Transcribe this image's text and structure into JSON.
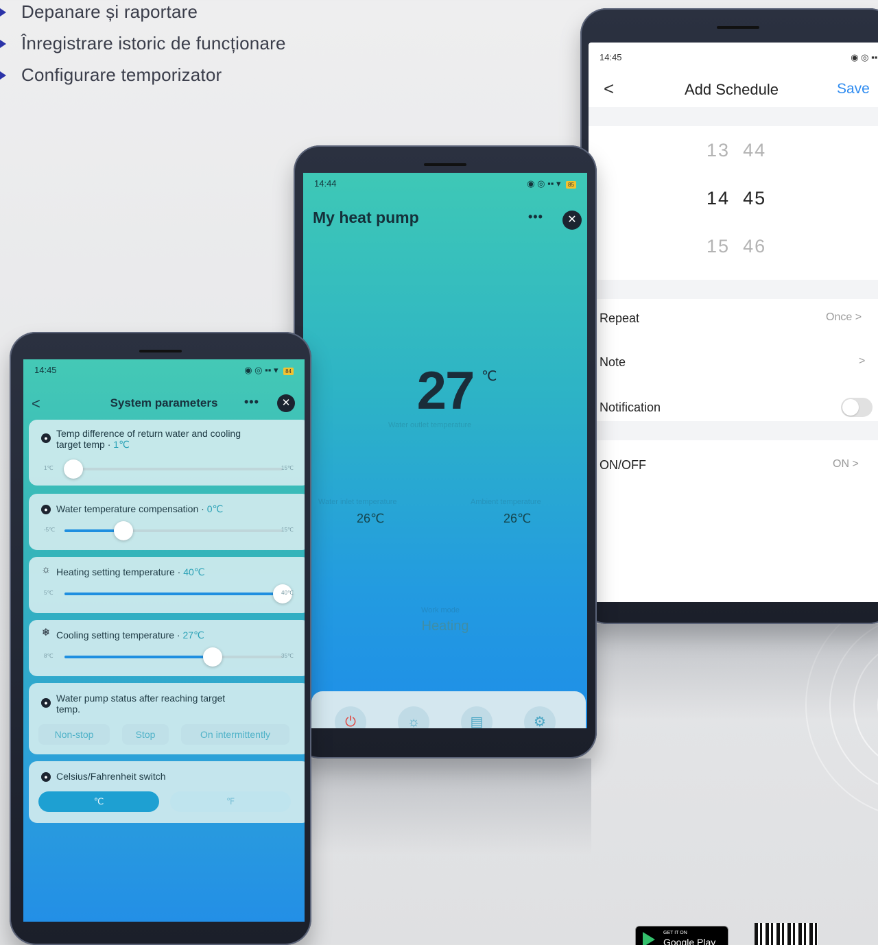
{
  "features": [
    "Depanare și raportare",
    "Înregistrare istoric de funcționare",
    "Configurare temporizator"
  ],
  "phone_system": {
    "status_time": "14:45",
    "battery": "84",
    "title": "System parameters",
    "back_glyph": "<",
    "more_glyph": "•••",
    "close_glyph": "✕",
    "cards": [
      {
        "label": "Temp difference of return water and cooling",
        "label2": "target temp",
        "value": "1℃",
        "min": "1℃",
        "max": "15℃",
        "fraction": 0.04
      },
      {
        "label": "Water temperature compensation",
        "value": "0℃",
        "min": "-5℃",
        "max": "15℃",
        "fraction": 0.27
      },
      {
        "label": "Heating setting temperature",
        "value": "40℃",
        "min": "5℃",
        "max": "40℃",
        "fraction": 1.0
      },
      {
        "label": "Cooling setting temperature",
        "value": "27℃",
        "min": "8℃",
        "max": "35℃",
        "fraction": 0.68
      }
    ],
    "pump_status": {
      "label": "Water pump status after reaching target",
      "label2": "temp.",
      "options": [
        "Non-stop",
        "Stop",
        "On intermittently"
      ]
    },
    "unit_switch": {
      "label": "Celsius/Fahrenheit switch",
      "options": [
        "℃",
        "℉"
      ],
      "selected": "℃"
    }
  },
  "phone_pump": {
    "status_time": "14:44",
    "battery": "85",
    "title": "My heat pump",
    "more_glyph": "•••",
    "close_glyph": "✕",
    "temperature": "27",
    "temperature_unit": "℃",
    "temperature_caption": "Water outlet temperature",
    "inlet_caption": "Water inlet temperature",
    "inlet_value": "26℃",
    "ambient_caption": "Ambient temperature",
    "ambient_value": "26℃",
    "mode_caption": "Work mode",
    "mode": "Heating",
    "nav_icons": [
      "power-icon",
      "sun-icon",
      "document-icon",
      "gear-icon"
    ]
  },
  "phone_schedule": {
    "status_time": "14:45",
    "battery": "85",
    "back_glyph": "<",
    "title": "Add Schedule",
    "save": "Save",
    "picker": [
      {
        "hour": "13",
        "minute": "44"
      },
      {
        "hour": "14",
        "minute": "45"
      },
      {
        "hour": "15",
        "minute": "46"
      }
    ],
    "repeat_label": "Repeat",
    "repeat_value": "Once",
    "note_label": "Note",
    "notification_label": "Notification",
    "notification_on": false,
    "onoff_label": "ON/OFF",
    "onoff_value": "ON",
    "chevron": ">"
  },
  "badges": {
    "google_small": "GET IT ON",
    "google_big": "Google Play"
  },
  "colors": {
    "accent_blue": "#2e8bf0",
    "bullet": "#2b33a8",
    "teal_top": "#3ec8b6",
    "blue_bottom": "#1e8ee8",
    "power_red": "#e0463f"
  }
}
